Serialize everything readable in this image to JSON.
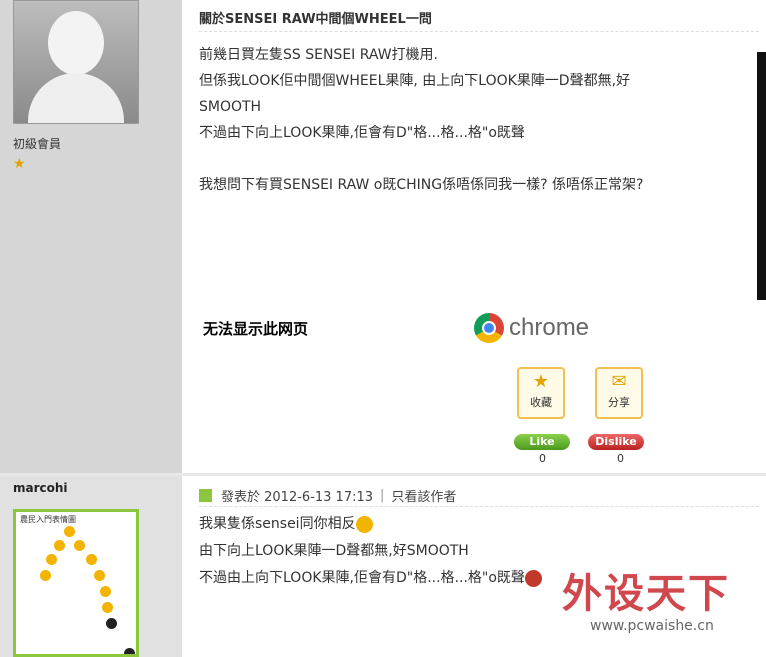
{
  "post1": {
    "rank": "初級會員",
    "title": "關於SENSEI RAW中間個WHEEL一問",
    "lines": [
      "前幾日買左隻SS SENSEI RAW打機用.",
      "但係我LOOK佢中間個WHEEL果陣, 由上向下LOOK果陣一D聲都無,好",
      "SMOOTH",
      "不過由下向上LOOK果陣,佢會有D\"格...格...格\"o既聲",
      "",
      "我想問下有買SENSEI RAW o既CHING係唔係同我一樣? 係唔係正常架?"
    ],
    "embed": {
      "error_text": "无法显示此网页",
      "brand_text": "chrome"
    },
    "actions": {
      "favorite_label": "收藏",
      "share_label": "分享",
      "like_label": "Like",
      "dislike_label": "Dislike",
      "like_count": "0",
      "dislike_count": "0"
    }
  },
  "post2": {
    "username": "marcohi",
    "avatar_caption": "農民入門表情圖",
    "meta": {
      "posted": "發表於 2012-6-13 17:13",
      "author_only": "只看該作者"
    },
    "lines": [
      "我果隻係sensei同你相反",
      "由下向上LOOK果陣一D聲都無,好SMOOTH",
      "不過由上向下LOOK果陣,佢會有D\"格...格...格\"o既聲"
    ]
  },
  "watermark": {
    "text": "外设天下",
    "url": "www.pcwaishe.cn"
  }
}
